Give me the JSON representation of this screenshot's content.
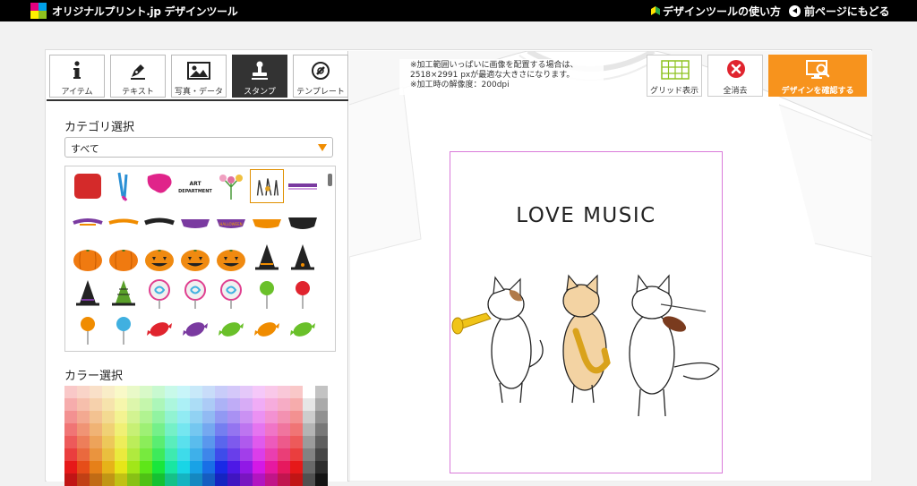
{
  "header": {
    "app_title": "オリジナルプリント.jp デザインツール",
    "help_link": "デザインツールの使い方",
    "back_link": "前ページにもどる"
  },
  "tool_tabs": [
    {
      "label": "アイテム",
      "icon": "info-icon"
    },
    {
      "label": "テキスト",
      "icon": "pen-icon"
    },
    {
      "label": "写真・データ",
      "icon": "image-icon"
    },
    {
      "label": "スタンプ",
      "icon": "stamp-icon",
      "active": true
    },
    {
      "label": "テンプレート",
      "icon": "template-icon"
    }
  ],
  "category": {
    "label": "カテゴリ選択",
    "selected": "すべて"
  },
  "stamps": [
    "red-square",
    "paint-brushes",
    "pink-splash",
    "art-department-text",
    "flower-bouquet",
    "cat-band-stamp",
    "purple-ribbon",
    "purple-orange-ribbon",
    "orange-ribbon",
    "black-ribbon",
    "purple-banner",
    "halloween-banner",
    "orange-banner",
    "black-banner",
    "pumpkin",
    "pumpkin",
    "jack-o-lantern",
    "jack-o-lantern",
    "jack-o-lantern",
    "witch-hat-orange",
    "witch-hat-black",
    "witch-hat-purple",
    "witch-hat-green",
    "lollipop-swirl",
    "lollipop-swirl",
    "lollipop-swirl",
    "lollipop-green",
    "lollipop-red",
    "lollipop-orange",
    "lollipop-blue",
    "candy-red",
    "candy-purple",
    "candy-green",
    "candy-orange",
    "candy-green"
  ],
  "color_section": {
    "label": "カラー選択"
  },
  "note": {
    "line1": "※加工範囲いっぱいに画像を配置する場合は、",
    "line2": "2518×2991 pxが最適な大きさになります。",
    "line3": "※加工時の解像度：200dpi"
  },
  "actions": {
    "grid": "グリッド表示",
    "clear": "全消去",
    "confirm": "デザインを確認する"
  },
  "design": {
    "title": "LOVE MUSIC"
  },
  "colors": {
    "accent": "#f7931d",
    "active_tab": "#333333",
    "print_area": "#d97ad9",
    "clear_red": "#e0242e",
    "grid_green": "#8dc21f"
  }
}
